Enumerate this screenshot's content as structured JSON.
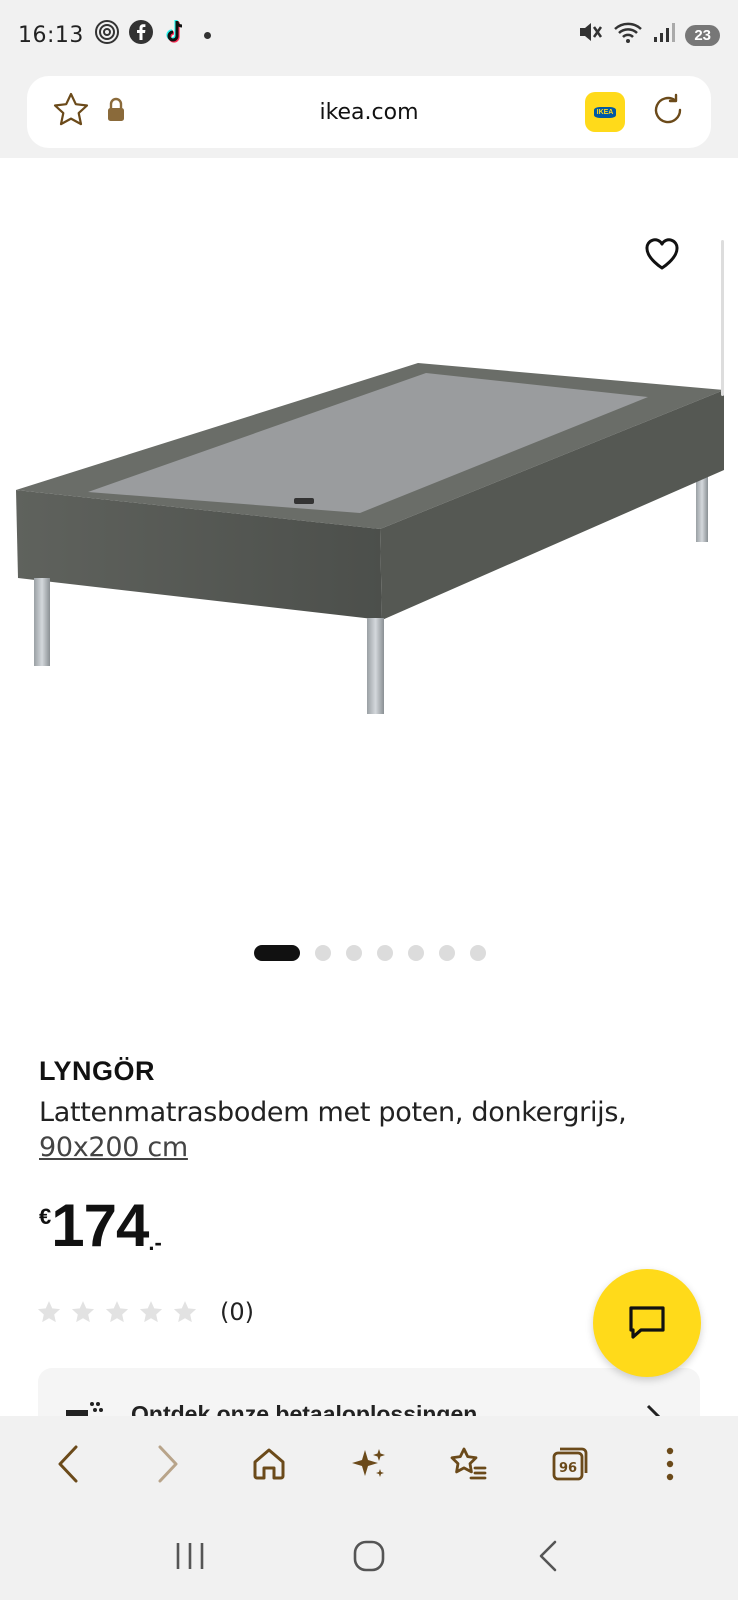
{
  "status_bar": {
    "time": "16:13",
    "battery": "23",
    "icons": [
      "fingerprint-icon",
      "facebook-icon",
      "tiktok-icon",
      "mute-icon",
      "wifi-icon",
      "signal-icon"
    ]
  },
  "browser": {
    "url": "ikea.com",
    "icons": [
      "star-icon",
      "lock-icon",
      "ikea-logo",
      "reload-icon"
    ]
  },
  "product": {
    "name": "LYNGÖR",
    "description": "Lattenmatrasbodem met poten, donkergrijs,",
    "size": "90x200 cm",
    "price_currency": "€",
    "price_amount": "174",
    "price_suffix": ".-",
    "rating_count": "(0)",
    "rating_stars": 0,
    "image_count": 7,
    "active_image": 1
  },
  "payment_card": {
    "label": "Ontdek onze betaaloplossingen"
  },
  "colors": {
    "ikea_yellow": "#ffda1a",
    "ikea_blue": "#0058a3",
    "browser_accent": "#6b4a1a",
    "bed_fabric": "#5a5d58",
    "bed_top": "#9a9c9e"
  },
  "toolbar": {
    "tabs_count": "96",
    "buttons": [
      "back-icon",
      "forward-icon",
      "home-icon",
      "sparkle-icon",
      "bookmarks-icon",
      "tabs-icon",
      "more-icon"
    ]
  }
}
